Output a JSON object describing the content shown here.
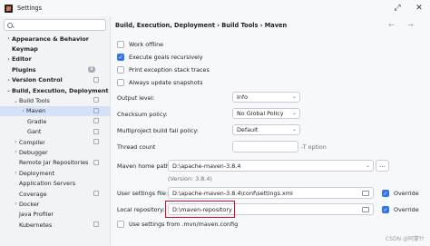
{
  "window": {
    "title": "Settings"
  },
  "search": {
    "placeholder": ""
  },
  "sidebar": {
    "items": [
      {
        "label": "Appearance & Behavior",
        "chevron": "›"
      },
      {
        "label": "Keymap",
        "chevron": ""
      },
      {
        "label": "Editor",
        "chevron": "›"
      },
      {
        "label": "Plugins",
        "chevron": "",
        "badge": "1"
      },
      {
        "label": "Version Control",
        "chevron": "›"
      },
      {
        "label": "Build, Execution, Deployment",
        "chevron": "⌄"
      },
      {
        "label": "Build Tools",
        "chevron": "⌄"
      },
      {
        "label": "Maven",
        "chevron": "›"
      },
      {
        "label": "Gradle",
        "chevron": ""
      },
      {
        "label": "Gant",
        "chevron": ""
      },
      {
        "label": "Compiler",
        "chevron": "›"
      },
      {
        "label": "Debugger",
        "chevron": "›"
      },
      {
        "label": "Remote Jar Repositories",
        "chevron": ""
      },
      {
        "label": "Deployment",
        "chevron": "›"
      },
      {
        "label": "Application Servers",
        "chevron": ""
      },
      {
        "label": "Coverage",
        "chevron": ""
      },
      {
        "label": "Docker",
        "chevron": "›"
      },
      {
        "label": "Java Profiler",
        "chevron": ""
      },
      {
        "label": "Kubernetes",
        "chevron": ""
      }
    ]
  },
  "main": {
    "breadcrumb": "Build, Execution, Deployment  ›  Build Tools  ›  Maven",
    "nav_arrows": "← →",
    "checkboxes": {
      "work_offline": "Work offline",
      "execute_goals": "Execute goals recursively",
      "print_exception": "Print exception stack traces",
      "always_update": "Always update snapshots"
    },
    "output_level": {
      "label": "Output level:",
      "value": "Info"
    },
    "checksum_policy": {
      "label": "Checksum policy:",
      "value": "No Global Policy"
    },
    "multiproject_fail": {
      "label": "Multiproject build fail policy:",
      "value": "Default"
    },
    "thread_count": {
      "label": "Thread count",
      "value": "",
      "hint": "-T option"
    },
    "maven_home": {
      "label": "Maven home path:",
      "value": "D:\\apache-maven-3.8.4",
      "browse": "…",
      "version": "(Version: 3.8.4)"
    },
    "user_settings": {
      "label": "User settings file:",
      "value": "D:\\apache-maven-3.8.4\\conf\\settings.xml",
      "override": "Override"
    },
    "local_repo": {
      "label": "Local repository:",
      "value": "D:\\maven-repository",
      "override": "Override"
    },
    "use_settings": "Use settings from .mvn/maven.config"
  },
  "watermark": "CSDN @阿蒙什",
  "colors": {
    "accent": "#3574f0",
    "highlight": "#c8102e",
    "selected_row": "#d5e1f7"
  }
}
